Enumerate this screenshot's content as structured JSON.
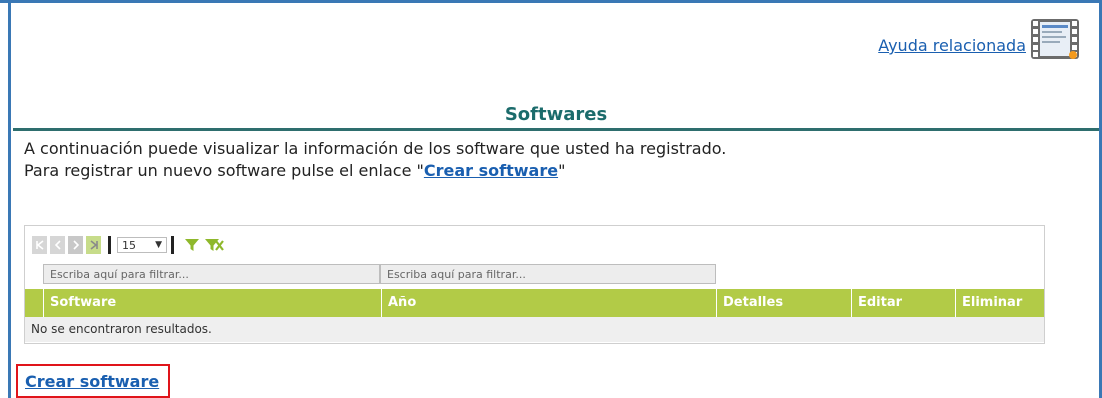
{
  "help": {
    "link_label": "Ayuda relacionada",
    "icon": "help-video-icon"
  },
  "page": {
    "title": "Softwares"
  },
  "intro": {
    "line1": "A continuación puede visualizar la información de los software que usted ha registrado.",
    "line2_prefix": "Para registrar un nuevo software pulse el enlace \"",
    "line2_link": "Crear software",
    "line2_suffix": "\""
  },
  "grid": {
    "pager": {
      "page_size": "15",
      "buttons": [
        "first-page-icon",
        "prev-page-icon",
        "next-page-icon",
        "last-page-icon"
      ]
    },
    "filters": [
      {
        "placeholder": "Escriba aquí para filtrar..."
      },
      {
        "placeholder": "Escriba aquí para filtrar..."
      }
    ],
    "columns": [
      "Software",
      "Año",
      "Detalles",
      "Editar",
      "Eliminar"
    ],
    "empty_message": "No se encontraron resultados."
  },
  "actions": {
    "create_label": "Crear software"
  },
  "colors": {
    "accent_green": "#b2cb47",
    "title_teal": "#1b6b6b",
    "link_blue": "#1a5fb0",
    "highlight_red": "#e0141a"
  }
}
